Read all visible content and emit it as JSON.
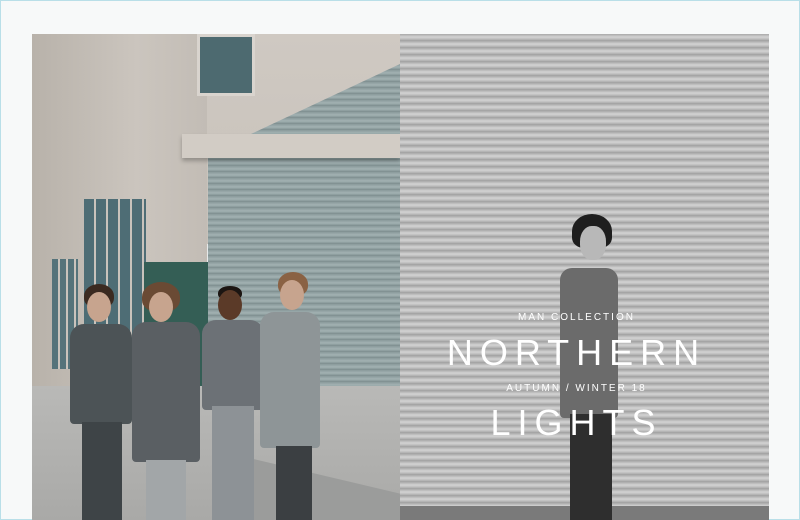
{
  "ad": {
    "collection_label": "MAN COLLECTION",
    "title_line1": "NORTHERN",
    "season_label": "AUTUMN / WINTER 18",
    "title_line2": "LIGHTS"
  },
  "colors": {
    "frame_border": "#b9dfe8",
    "shutter_green": "#8a9a9b",
    "green_base": "#345e55",
    "text": "#ffffff"
  }
}
